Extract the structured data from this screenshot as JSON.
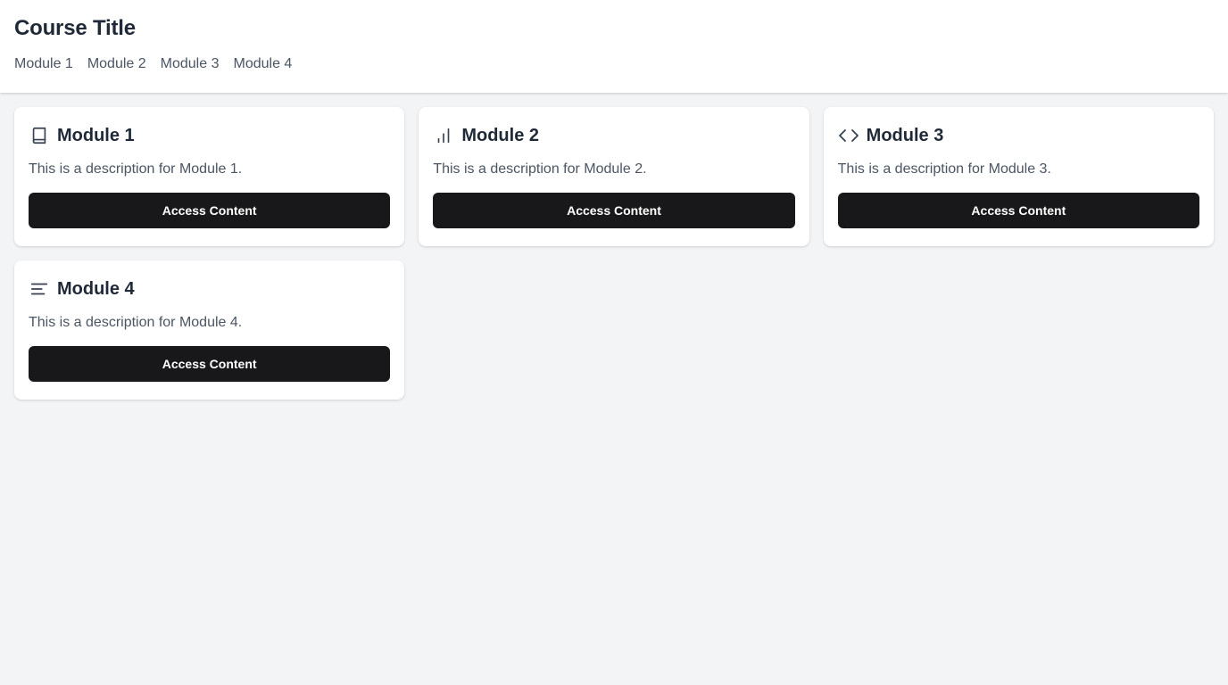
{
  "header": {
    "title": "Course Title",
    "nav": [
      {
        "label": "Module 1"
      },
      {
        "label": "Module 2"
      },
      {
        "label": "Module 3"
      },
      {
        "label": "Module 4"
      }
    ]
  },
  "modules": [
    {
      "icon": "book-icon",
      "title": "Module 1",
      "description": "This is a description for Module 1.",
      "button": "Access Content"
    },
    {
      "icon": "bar-chart-icon",
      "title": "Module 2",
      "description": "This is a description for Module 2.",
      "button": "Access Content"
    },
    {
      "icon": "code-icon",
      "title": "Module 3",
      "description": "This is a description for Module 3.",
      "button": "Access Content"
    },
    {
      "icon": "align-left-icon",
      "title": "Module 4",
      "description": "This is a description for Module 4.",
      "button": "Access Content"
    }
  ],
  "colors": {
    "background": "#f3f4f6",
    "card": "#ffffff",
    "button": "#18181b",
    "text": "#1f2937",
    "muted": "#4b5563"
  }
}
